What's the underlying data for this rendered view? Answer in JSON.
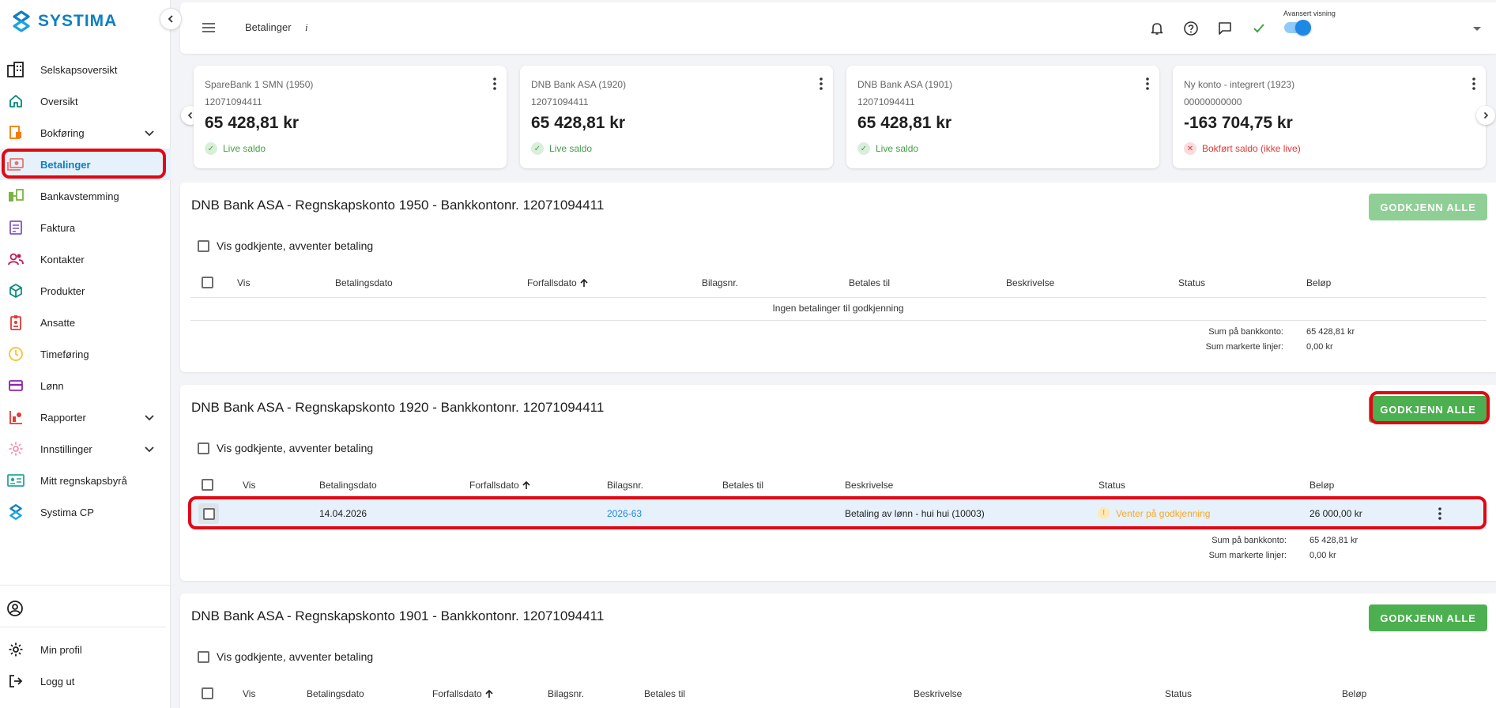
{
  "app": {
    "brand": "SYSTIMA",
    "colors": {
      "brand": "#0d7fc3",
      "approve": "#4caf50",
      "approve_disabled": "#8fcf96",
      "pending": "#f9a825",
      "ok": "#43a047",
      "error": "#e53935",
      "annotation": "#e30613"
    }
  },
  "sidebar": {
    "items": [
      {
        "label": "Selskapsoversikt",
        "icon": "building-icon"
      },
      {
        "label": "Oversikt",
        "icon": "home-icon"
      },
      {
        "label": "Bokføring",
        "icon": "ledger-icon",
        "expandable": true
      },
      {
        "label": "Betalinger",
        "icon": "payments-icon",
        "active": true
      },
      {
        "label": "Bankavstemming",
        "icon": "bank-reconcile-icon"
      },
      {
        "label": "Faktura",
        "icon": "invoice-icon"
      },
      {
        "label": "Kontakter",
        "icon": "contacts-icon"
      },
      {
        "label": "Produkter",
        "icon": "box-icon"
      },
      {
        "label": "Ansatte",
        "icon": "badge-icon"
      },
      {
        "label": "Timeføring",
        "icon": "clock-icon"
      },
      {
        "label": "Lønn",
        "icon": "card-icon"
      },
      {
        "label": "Rapporter",
        "icon": "reports-icon",
        "expandable": true
      },
      {
        "label": "Innstillinger",
        "icon": "gear-icon",
        "expandable": true
      },
      {
        "label": "Mitt regnskapsbyrå",
        "icon": "id-card-icon"
      },
      {
        "label": "Systima CP",
        "icon": "systima-icon"
      }
    ],
    "bottom": [
      {
        "label": "Min profil",
        "icon": "gear-icon"
      },
      {
        "label": "Logg ut",
        "icon": "logout-icon"
      }
    ]
  },
  "topbar": {
    "title": "Betalinger",
    "info": "i",
    "advanced_label": "Avansert visning",
    "advanced_on": true
  },
  "cards": [
    {
      "name": "SpareBank 1 SMN (1950)",
      "number": "12071094411",
      "balance": "65 428,81 kr",
      "status": "Live saldo",
      "status_type": "ok"
    },
    {
      "name": "DNB Bank ASA (1920)",
      "number": "12071094411",
      "balance": "65 428,81 kr",
      "status": "Live saldo",
      "status_type": "ok"
    },
    {
      "name": "DNB Bank ASA (1901)",
      "number": "12071094411",
      "balance": "65 428,81 kr",
      "status": "Live saldo",
      "status_type": "ok"
    },
    {
      "name": "Ny konto - integrert (1923)",
      "number": "00000000000",
      "balance": "-163 704,75 kr",
      "status": "Bokført saldo (ikke live)",
      "status_type": "err"
    }
  ],
  "sections": [
    {
      "title": "DNB Bank ASA - Regnskapskonto 1950 - Bankkontonr. 12071094411",
      "approve_label": "GODKJENN ALLE",
      "show_approved_label": "Vis godkjente, avventer betaling",
      "headers": [
        "Vis",
        "Betalingsdato",
        "Forfallsdato",
        "Bilagsnr.",
        "Betales til",
        "Beskrivelse",
        "Status",
        "Beløp"
      ],
      "empty_message": "Ingen betalinger til godkjenning",
      "sum_bank_label": "Sum på bankkonto:",
      "sum_bank_value": "65 428,81 kr",
      "sum_marked_label": "Sum markerte linjer:",
      "sum_marked_value": "0,00 kr"
    },
    {
      "title": "DNB Bank ASA - Regnskapskonto 1920 - Bankkontonr. 12071094411",
      "approve_label": "GODKJENN ALLE",
      "show_approved_label": "Vis godkjente, avventer betaling",
      "headers": [
        "Vis",
        "Betalingsdato",
        "Forfallsdato",
        "Bilagsnr.",
        "Betales til",
        "Beskrivelse",
        "Status",
        "Beløp"
      ],
      "rows": [
        {
          "payment_date": "14.04.2026",
          "voucher": "2026-63",
          "description": "Betaling av lønn - hui hui (10003)",
          "status": "Venter på godkjenning",
          "amount": "26 000,00 kr"
        }
      ],
      "sum_bank_label": "Sum på bankkonto:",
      "sum_bank_value": "65 428,81 kr",
      "sum_marked_label": "Sum markerte linjer:",
      "sum_marked_value": "0,00 kr"
    },
    {
      "title": "DNB Bank ASA - Regnskapskonto 1901 - Bankkontonr. 12071094411",
      "approve_label": "GODKJENN ALLE",
      "show_approved_label": "Vis godkjente, avventer betaling",
      "headers": [
        "Vis",
        "Betalingsdato",
        "Forfallsdato",
        "Bilagsnr.",
        "Betales til",
        "Beskrivelse",
        "Status",
        "Beløp"
      ]
    }
  ]
}
